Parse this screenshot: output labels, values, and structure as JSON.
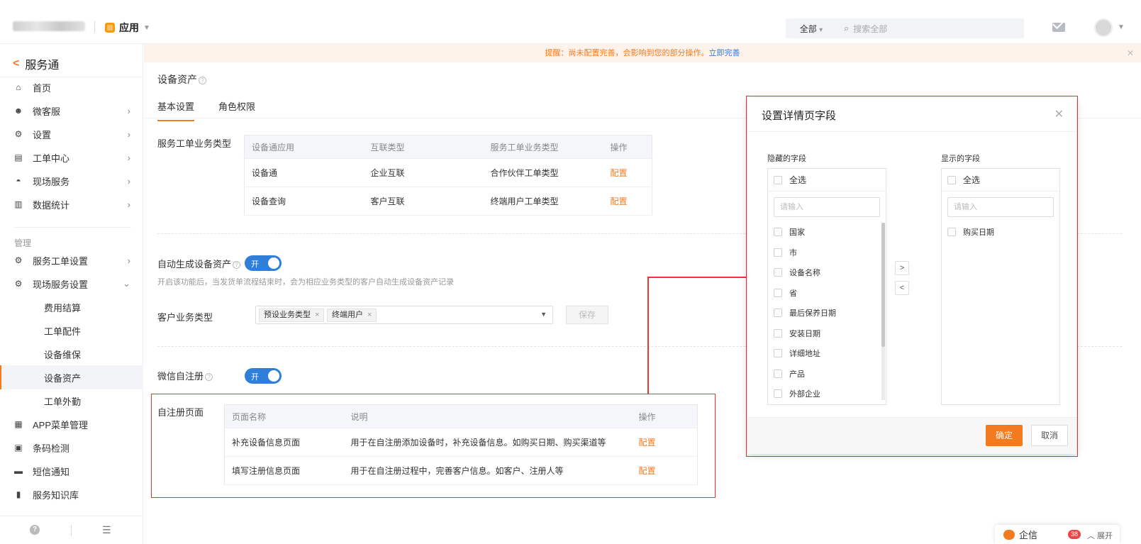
{
  "app": {
    "switcher_label": "应用"
  },
  "search": {
    "scope": "全部",
    "placeholder": "搜索全部"
  },
  "sidebar": {
    "title": "服务通",
    "items": [
      {
        "label": "首页",
        "icon": "home-icon"
      },
      {
        "label": "微客服",
        "icon": "agent-icon"
      },
      {
        "label": "设置",
        "icon": "gear-icon"
      },
      {
        "label": "工单中心",
        "icon": "ticket-icon"
      },
      {
        "label": "现场服务",
        "icon": "helmet-icon"
      },
      {
        "label": "数据统计",
        "icon": "bar-chart-icon"
      }
    ],
    "group_label": "管理",
    "manage_items": [
      {
        "label": "服务工单设置",
        "icon": "ticket-settings-icon"
      },
      {
        "label": "现场服务设置",
        "icon": "field-settings-icon"
      }
    ],
    "sub_items": [
      "费用结算",
      "工单配件",
      "设备维保",
      "设备资产",
      "工单外勤"
    ],
    "active_sub": "设备资产",
    "bottom_items": [
      {
        "label": "APP菜单管理",
        "icon": "grid-icon"
      },
      {
        "label": "条码检测",
        "icon": "barcode-icon"
      },
      {
        "label": "短信通知",
        "icon": "message-icon"
      },
      {
        "label": "服务知识库",
        "icon": "book-icon"
      }
    ]
  },
  "notice": {
    "text": "提醒：尚未配置完善，会影响到您的部分操作。",
    "link": "立即完善"
  },
  "page": {
    "title": "设备资产"
  },
  "tabs": [
    "基本设置",
    "角色权限"
  ],
  "business_types": {
    "label": "服务工单业务类型",
    "columns": [
      "设备通应用",
      "互联类型",
      "服务工单业务类型",
      "操作"
    ],
    "rows": [
      [
        "设备通",
        "企业互联",
        "合作伙伴工单类型",
        "配置"
      ],
      [
        "设备查询",
        "客户互联",
        "终端用户工单类型",
        "配置"
      ]
    ]
  },
  "auto_generate": {
    "label": "自动生成设备资产",
    "toggle": "开",
    "hint": "开启该功能后，当发货单流程结束时，会为相应业务类型的客户自动生成设备资产记录"
  },
  "customer_type": {
    "label": "客户业务类型",
    "tags": [
      "预设业务类型",
      "终端用户"
    ],
    "save_label": "保存"
  },
  "wechat_register": {
    "label": "微信自注册",
    "toggle": "开"
  },
  "register_pages": {
    "label": "自注册页面",
    "columns": [
      "页面名称",
      "说明",
      "操作"
    ],
    "rows": [
      [
        "补充设备信息页面",
        "用于在自注册添加设备时，补充设备信息。如购买日期、购买渠道等",
        "配置"
      ],
      [
        "填写注册信息页面",
        "用于在自注册过程中，完善客户信息。如客户、注册人等",
        "配置"
      ]
    ]
  },
  "modal": {
    "title": "设置详情页字段",
    "hidden_label": "隐藏的字段",
    "shown_label": "显示的字段",
    "select_all": "全选",
    "input_placeholder": "请输入",
    "hidden_fields": [
      "国家",
      "市",
      "设备名称",
      "省",
      "最后保养日期",
      "安装日期",
      "详细地址",
      "产品",
      "外部企业"
    ],
    "shown_fields": [
      "购买日期"
    ],
    "ok_label": "确定",
    "cancel_label": "取消"
  },
  "chat": {
    "name": "企信",
    "badge": "38",
    "expand": "展开"
  },
  "colors": {
    "accent": "#f47a20",
    "toggle": "#2f7fd8",
    "highlight": "#e33333"
  }
}
